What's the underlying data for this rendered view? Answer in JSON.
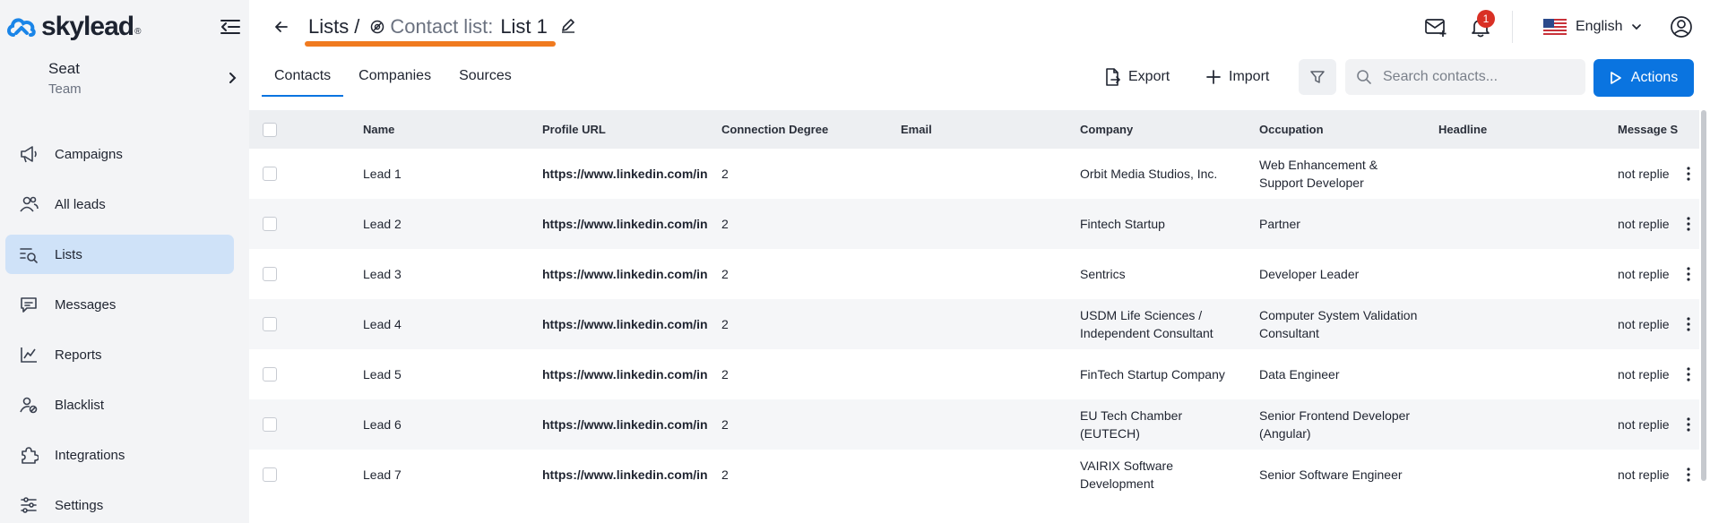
{
  "brand": {
    "name": "skylead",
    "reg": "®"
  },
  "seat": {
    "name": "Seat",
    "team": "Team"
  },
  "sidebar": {
    "items": [
      {
        "label": "Campaigns",
        "icon": "megaphone-icon",
        "active": false
      },
      {
        "label": "All leads",
        "icon": "users-icon",
        "active": false
      },
      {
        "label": "Lists",
        "icon": "list-search-icon",
        "active": true
      },
      {
        "label": "Messages",
        "icon": "message-icon",
        "active": false
      },
      {
        "label": "Reports",
        "icon": "chart-icon",
        "active": false
      },
      {
        "label": "Blacklist",
        "icon": "user-block-icon",
        "active": false
      },
      {
        "label": "Integrations",
        "icon": "puzzle-icon",
        "active": false
      },
      {
        "label": "Settings",
        "icon": "sliders-icon",
        "active": false
      }
    ]
  },
  "header": {
    "breadcrumb_root": "Lists",
    "breadcrumb_sep": "/",
    "list_label": "Contact list:",
    "list_name": "List 1",
    "notification_count": "1",
    "language": "English"
  },
  "tabs": [
    {
      "label": "Contacts",
      "active": true
    },
    {
      "label": "Companies",
      "active": false
    },
    {
      "label": "Sources",
      "active": false
    }
  ],
  "toolbar": {
    "export_label": "Export",
    "import_label": "Import",
    "search_placeholder": "Search contacts...",
    "actions_label": "Actions"
  },
  "table": {
    "columns": [
      "Name",
      "Profile URL",
      "Connection Degree",
      "Email",
      "Company",
      "Occupation",
      "Headline",
      "Message S"
    ],
    "rows": [
      {
        "name": "Lead 1",
        "url": "https://www.linkedin.com/in",
        "degree": "2",
        "email": "",
        "company": "Orbit Media Studios, Inc.",
        "occupation": "Web Enhancement & Support Developer",
        "headline": "",
        "status": "not replie"
      },
      {
        "name": "Lead 2",
        "url": "https://www.linkedin.com/in",
        "degree": "2",
        "email": "",
        "company": "Fintech Startup",
        "occupation": "Partner",
        "headline": "",
        "status": "not replie"
      },
      {
        "name": "Lead 3",
        "url": "https://www.linkedin.com/in",
        "degree": "2",
        "email": "",
        "company": "Sentrics",
        "occupation": "Developer Leader",
        "headline": "",
        "status": "not replie"
      },
      {
        "name": "Lead 4",
        "url": "https://www.linkedin.com/in",
        "degree": "2",
        "email": "",
        "company": "USDM Life Sciences / Independent Consultant",
        "occupation": "Computer System Validation Consultant",
        "headline": "",
        "status": "not replie"
      },
      {
        "name": "Lead 5",
        "url": "https://www.linkedin.com/in",
        "degree": "2",
        "email": "",
        "company": "FinTech Startup Company",
        "occupation": "Data Engineer",
        "headline": "",
        "status": "not replie"
      },
      {
        "name": "Lead 6",
        "url": "https://www.linkedin.com/in",
        "degree": "2",
        "email": "",
        "company": "EU Tech Chamber (EUTECH)",
        "occupation": "Senior Frontend Developer (Angular)",
        "headline": "",
        "status": "not replie"
      },
      {
        "name": "Lead 7",
        "url": "https://www.linkedin.com/in",
        "degree": "2",
        "email": "",
        "company": "VAIRIX Software Development",
        "occupation": "Senior Software Engineer",
        "headline": "",
        "status": "not replie"
      }
    ]
  },
  "colors": {
    "accent": "#0a74e0",
    "active_nav_bg": "#cfe2f8",
    "highlight_underline": "#f07a1f",
    "badge": "#d93025"
  }
}
